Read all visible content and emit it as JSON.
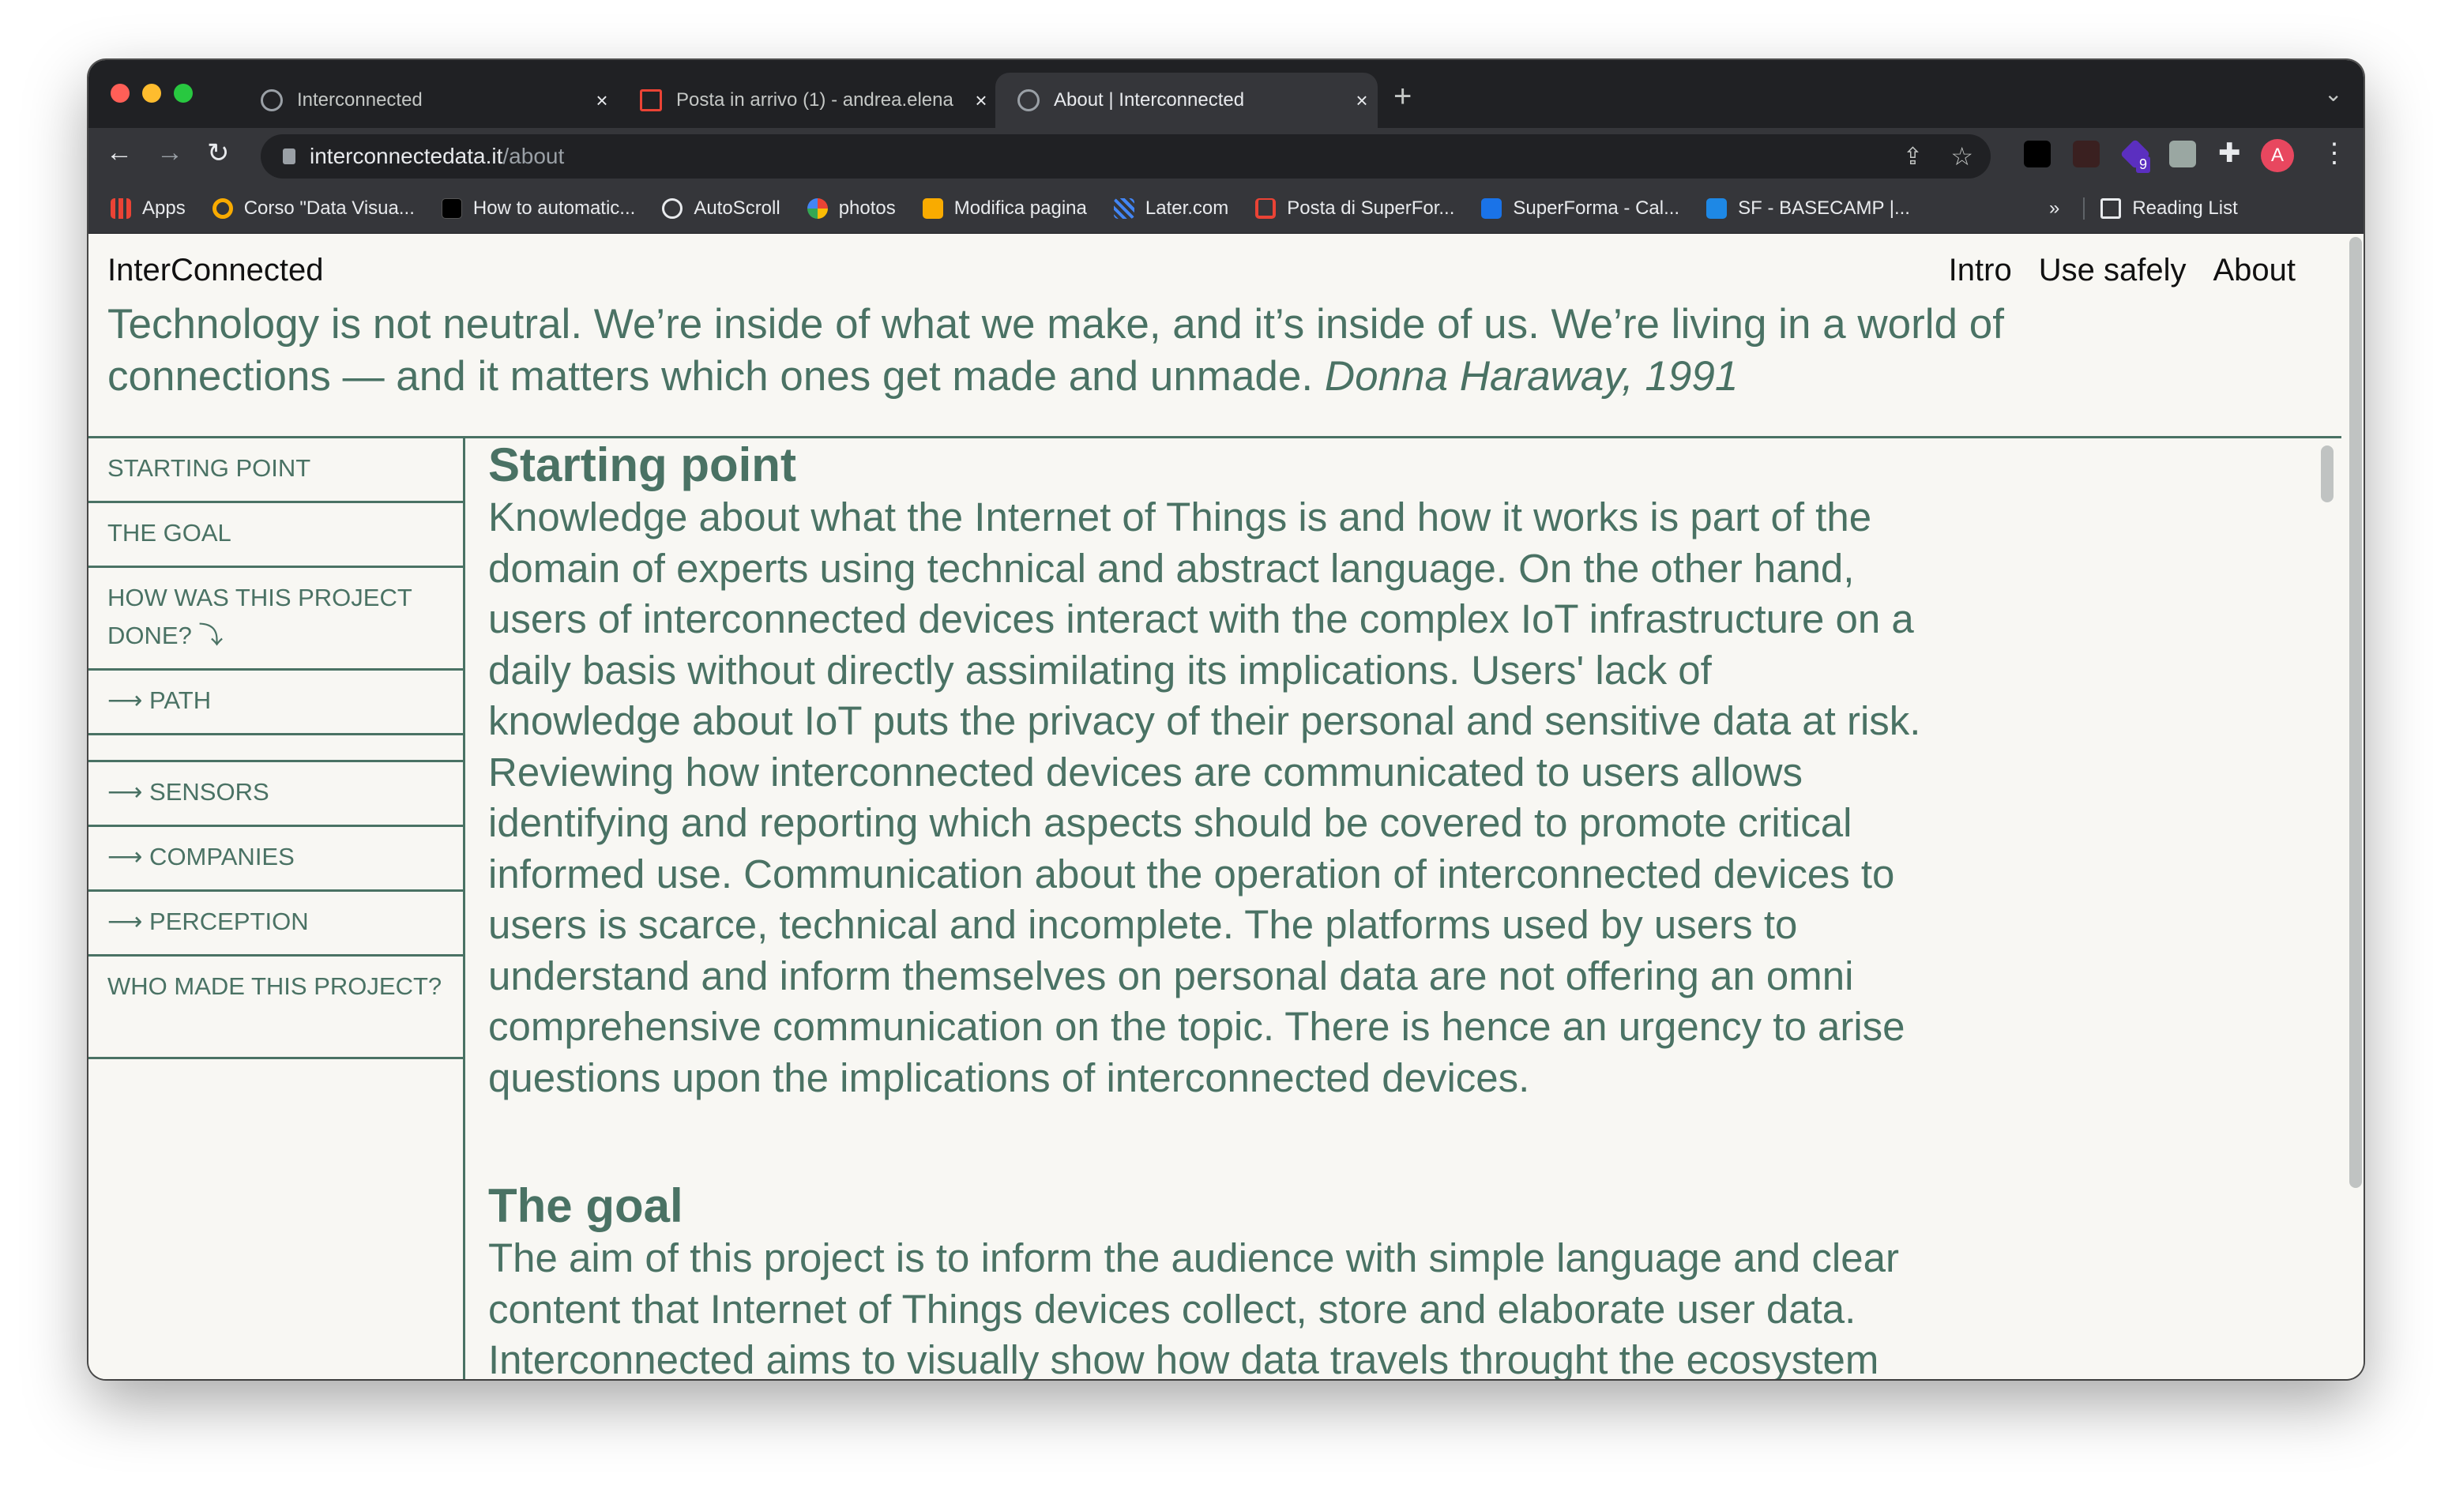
{
  "browser": {
    "tabs": [
      {
        "title": "Interconnected",
        "active": false
      },
      {
        "title": "Posta in arrivo (1) - andrea.elena",
        "active": false
      },
      {
        "title": "About | Interconnected",
        "active": true
      }
    ],
    "url_host": "interconnectedata.it",
    "url_path": "/about",
    "profile_initial": "A",
    "extension_badge": "9",
    "bookmarks": [
      "Apps",
      "Corso \"Data Visua...",
      "How to automatic...",
      "AutoScroll",
      "photos",
      "Modifica pagina",
      "Later.com",
      "Posta di SuperFor...",
      "SuperForma - Cal...",
      "SF - BASECAMP |..."
    ],
    "bookmarks_overflow": "»",
    "reading_list": "Reading List"
  },
  "site": {
    "title": "InterConnected",
    "nav": [
      "Intro",
      "Use safely",
      "About"
    ],
    "quote": "Technology is not neutral. We’re inside of what we make, and it’s inside of us. We’re living in a world of connections — and it matters which ones get made and unmade.",
    "quote_author": "Donna Haraway, 1991"
  },
  "sidebar": {
    "items": [
      "Starting point",
      "The goal",
      "How was this project done? ⤵",
      "⟶ Path",
      "⟶ Sensors",
      "⟶ Companies",
      "⟶ Perception",
      "Who made this project?"
    ]
  },
  "content": {
    "sections": [
      {
        "heading": "Starting point",
        "lines": [
          "Knowledge about what the Internet of Things is and how it works is part of the",
          "domain of experts using technical and abstract language. On the other hand,",
          "users of interconnected devices interact with the complex IoT infrastructure on a",
          "daily basis without directly assimilating its implications. Users' lack of",
          "knowledge about IoT puts the privacy of their personal and sensitive data at risk.",
          "Reviewing how interconnected devices are communicated to users allows",
          "identifying and reporting which aspects should be covered to promote critical",
          "informed use. Communication about the operation of interconnected devices to",
          "users is scarce, technical and incomplete. The platforms used by users to",
          "understand and inform themselves on personal data are not offering an omni",
          "comprehensive communication on the topic. There is hence an urgency to arise",
          "questions upon the implications of interconnected devices."
        ]
      },
      {
        "heading": "The goal",
        "lines": [
          "The aim of this project is to inform the audience with simple language and clear",
          "content that Internet of Things devices collect, store and elaborate user data.",
          "Interconnected aims to visually show how data travels throught the ecosystem"
        ]
      }
    ]
  },
  "colors": {
    "accent": "#4a7264",
    "page_bg": "#f8f7f3",
    "chrome_dark": "#202124",
    "chrome": "#35363a"
  }
}
